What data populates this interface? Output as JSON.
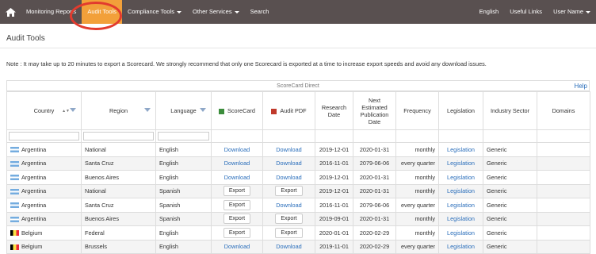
{
  "nav": {
    "items": [
      "Monitoring Reports",
      "Audit Tools",
      "Compliance Tools",
      "Other Services",
      "Search"
    ],
    "right": [
      "English",
      "Useful Links",
      "User Name"
    ]
  },
  "page": {
    "title": "Audit Tools",
    "note": "Note : It may take up to 20 minutes to export a Scorecard. We strongly recommend that only one Scorecard is exported at a time to increase export speeds and avoid any download issues."
  },
  "table": {
    "scorecard_title": "ScoreCard Direct",
    "help": "Help",
    "headers": [
      "Country",
      "Region",
      "Language",
      "ScoreCard",
      "Audit PDF",
      "Research Date",
      "Next Estimated Publication Date",
      "Frequency",
      "Legislation",
      "Industry Sector",
      "Domains"
    ],
    "rows": [
      {
        "country": "Argentina",
        "flag": "ar",
        "region": "National",
        "language": "English",
        "scorecard": "Download",
        "pdf": "Download",
        "research": "2019-12-01",
        "next": "2020-01-31",
        "frequency": "monthly",
        "legislation": "Legislation",
        "sector": "Generic",
        "domains": ""
      },
      {
        "country": "Argentina",
        "flag": "ar",
        "region": "Santa Cruz",
        "language": "English",
        "scorecard": "Download",
        "pdf": "Download",
        "research": "2016-11-01",
        "next": "2079-06-06",
        "frequency": "every quarter",
        "legislation": "Legislation",
        "sector": "Generic",
        "domains": ""
      },
      {
        "country": "Argentina",
        "flag": "ar",
        "region": "Buenos Aires",
        "language": "English",
        "scorecard": "Download",
        "pdf": "Download",
        "research": "2019-12-01",
        "next": "2020-01-31",
        "frequency": "monthly",
        "legislation": "Legislation",
        "sector": "Generic",
        "domains": ""
      },
      {
        "country": "Argentina",
        "flag": "ar",
        "region": "National",
        "language": "Spanish",
        "scorecard": "Export",
        "pdf": "Export",
        "research": "2019-12-01",
        "next": "2020-01-31",
        "frequency": "monthly",
        "legislation": "Legislation",
        "sector": "Generic",
        "domains": ""
      },
      {
        "country": "Argentina",
        "flag": "ar",
        "region": "Santa Cruz",
        "language": "Spanish",
        "scorecard": "Export",
        "pdf": "Download",
        "research": "2016-11-01",
        "next": "2079-06-06",
        "frequency": "every quarter",
        "legislation": "Legislation",
        "sector": "Generic",
        "domains": ""
      },
      {
        "country": "Argentina",
        "flag": "ar",
        "region": "Buenos Aires",
        "language": "Spanish",
        "scorecard": "Export",
        "pdf": "Export",
        "research": "2019-09-01",
        "next": "2020-01-31",
        "frequency": "monthly",
        "legislation": "Legislation",
        "sector": "Generic",
        "domains": ""
      },
      {
        "country": "Belgium",
        "flag": "be",
        "region": "Federal",
        "language": "English",
        "scorecard": "Export",
        "pdf": "Export",
        "research": "2020-01-01",
        "next": "2020-02-29",
        "frequency": "monthly",
        "legislation": "Legislation",
        "sector": "Generic",
        "domains": ""
      },
      {
        "country": "Belgium",
        "flag": "be",
        "region": "Brussels",
        "language": "English",
        "scorecard": "Download",
        "pdf": "Download",
        "research": "2019-11-01",
        "next": "2020-02-29",
        "frequency": "every quarter",
        "legislation": "Legislation",
        "sector": "Generic",
        "domains": ""
      }
    ]
  }
}
